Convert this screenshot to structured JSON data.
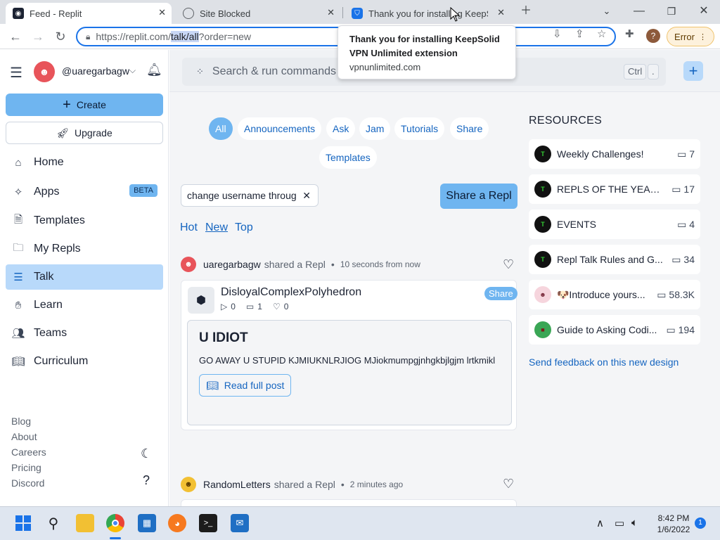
{
  "browser": {
    "tabs": [
      {
        "title": "Feed - Replit",
        "icon": "replit-icon"
      },
      {
        "title": "Site Blocked",
        "icon": "globe-icon"
      },
      {
        "title": "Thank you for installing KeepSolid",
        "icon": "shield-icon"
      }
    ],
    "url_host": "https://replit.com/",
    "url_selected": "talk/all",
    "url_rest": "?order=new",
    "error_button": "Error",
    "profile_letter": "?"
  },
  "popup": {
    "title": "Thank you for installing KeepSolid VPN Unlimited extension",
    "domain": "vpnunlimited.com"
  },
  "sidebar": {
    "username": "@uaregarbagw",
    "create_label": "Create",
    "upgrade_label": "Upgrade",
    "nav": [
      {
        "label": "Home",
        "icon": "home-icon"
      },
      {
        "label": "Apps",
        "icon": "sparkle-icon",
        "badge": "BETA"
      },
      {
        "label": "Templates",
        "icon": "template-icon"
      },
      {
        "label": "My Repls",
        "icon": "folder-icon"
      },
      {
        "label": "Talk",
        "icon": "list-icon"
      },
      {
        "label": "Learn",
        "icon": "hand-icon"
      },
      {
        "label": "Teams",
        "icon": "people-icon"
      },
      {
        "label": "Curriculum",
        "icon": "book-icon"
      }
    ],
    "footer": [
      "Blog",
      "About",
      "Careers",
      "Pricing",
      "Discord"
    ]
  },
  "topbar": {
    "search_placeholder": "Search & run commands",
    "shortcut_ctrl": "Ctrl",
    "shortcut_key": "."
  },
  "feed": {
    "chips": [
      "All",
      "Announcements",
      "Ask",
      "Jam",
      "Tutorials",
      "Share",
      "Templates"
    ],
    "active_chip": "All",
    "filter_text": "change username throug",
    "share_button": "Share a Repl",
    "sort": [
      "Hot",
      "New",
      "Top"
    ],
    "posts": [
      {
        "author": "uaregarbagw",
        "action": "shared a Repl",
        "time": "10 seconds from now",
        "repl_name": "DisloyalComplexPolyhedron",
        "runs": "0",
        "comments": "1",
        "likes": "0",
        "tag": "Share",
        "title": "U IDIOT",
        "body": "GO AWAY U STUPID KJMIUKNLRJIOG MJiokmumpgjnhgkbjlgjm lrtkmikl",
        "read_more": "Read full post"
      },
      {
        "author": "RandomLetters",
        "action": "shared a Repl",
        "time": "2 minutes ago"
      }
    ]
  },
  "resources": {
    "heading": "RESOURCES",
    "items": [
      {
        "title": "Weekly Challenges!",
        "count": "7"
      },
      {
        "title": "REPLS OF THE YEAR ...",
        "count": "17"
      },
      {
        "title": "EVENTS",
        "count": "4"
      },
      {
        "title": "Repl Talk Rules and G...",
        "count": "34"
      },
      {
        "title": "🐶Introduce yours...",
        "count": "58.3K"
      },
      {
        "title": "Guide to Asking Codi...",
        "count": "194"
      }
    ],
    "feedback": "Send feedback on this new design"
  },
  "taskbar": {
    "time": "8:42 PM",
    "date": "1/6/2022",
    "notifications": "1"
  }
}
